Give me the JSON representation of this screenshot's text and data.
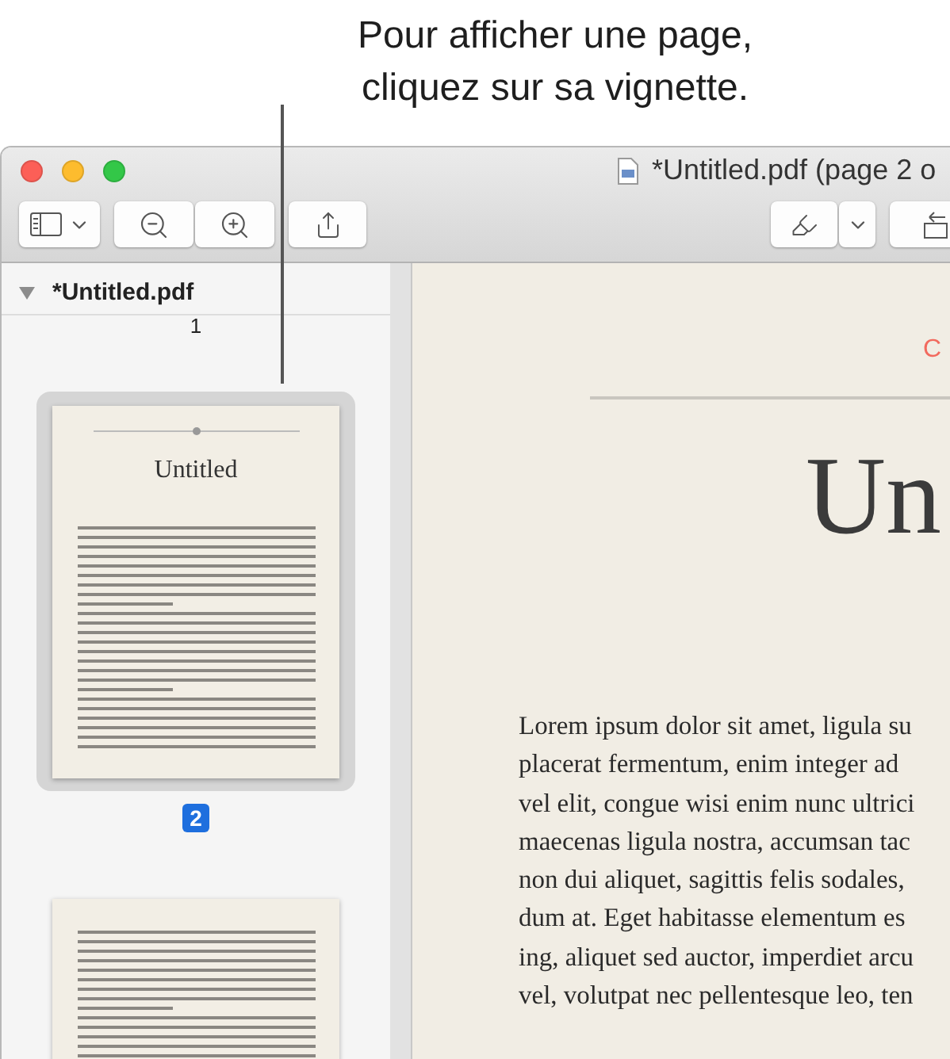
{
  "callout": {
    "lines": [
      "Pour afficher une page,",
      "cliquez sur sa vignette."
    ]
  },
  "window": {
    "title": "*Untitled.pdf (page 2 o"
  },
  "sidebar": {
    "document": {
      "name": "*Untitled.pdf",
      "expanded": true
    },
    "pages": [
      {
        "kind": "label-only",
        "label": "1",
        "selected": false
      },
      {
        "kind": "title-page",
        "label": "2",
        "selected": true,
        "title": "Untitled"
      },
      {
        "kind": "text-page",
        "selected": false
      }
    ]
  },
  "page": {
    "chapter": "C",
    "title": "Un",
    "lines": [
      "Lorem ipsum dolor sit amet, ligula su",
      "placerat fermentum, enim integer ad",
      "vel elit, congue wisi enim nunc ultrici",
      "maecenas ligula nostra, accumsan tac",
      "non dui aliquet, sagittis felis sodales,",
      "dum at. Eget habitasse elementum es",
      "ing, aliquet sed auctor, imperdiet arcu",
      "vel, volutpat nec pellentesque leo, ten"
    ]
  }
}
